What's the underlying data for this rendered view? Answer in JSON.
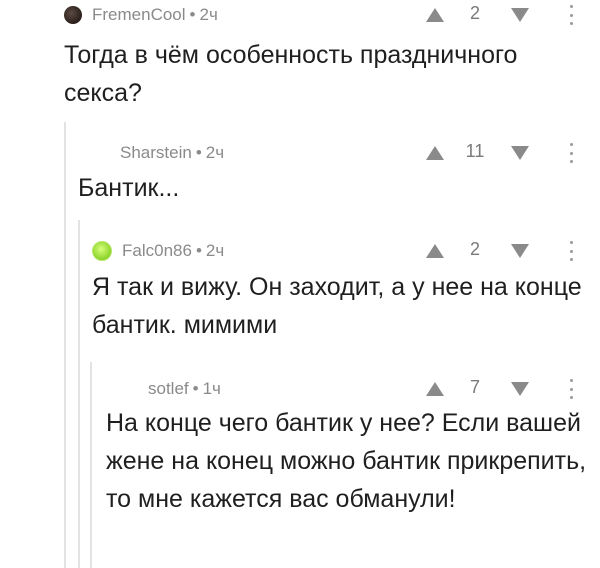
{
  "comments": [
    {
      "author": "FremenCool",
      "time": "2ч",
      "rating": "2",
      "avatar_icon": "dark-circle-avatar",
      "text": "Тогда в чём особенность праздничного секса?"
    },
    {
      "author": "Sharstein",
      "time": "2ч",
      "rating": "11",
      "text": "Бантик..."
    },
    {
      "author": "Falc0n86",
      "time": "2ч",
      "rating": "2",
      "avatar_icon": "green-blob-avatar",
      "text": "Я так и вижу. Он заходит, а у нее на конце бантик. мимими"
    },
    {
      "author": "sotlef",
      "time": "1ч",
      "rating": "7",
      "text": "На конце чего бантик у нее? Если вашей жене на конец можно бантик прикрепить, то мне кажется вас обманули!"
    }
  ],
  "separator": "•",
  "colors": {
    "meta_text": "#8a8a8a",
    "body_text": "#1f1f1f",
    "thread_line": "#e3e3e3"
  }
}
